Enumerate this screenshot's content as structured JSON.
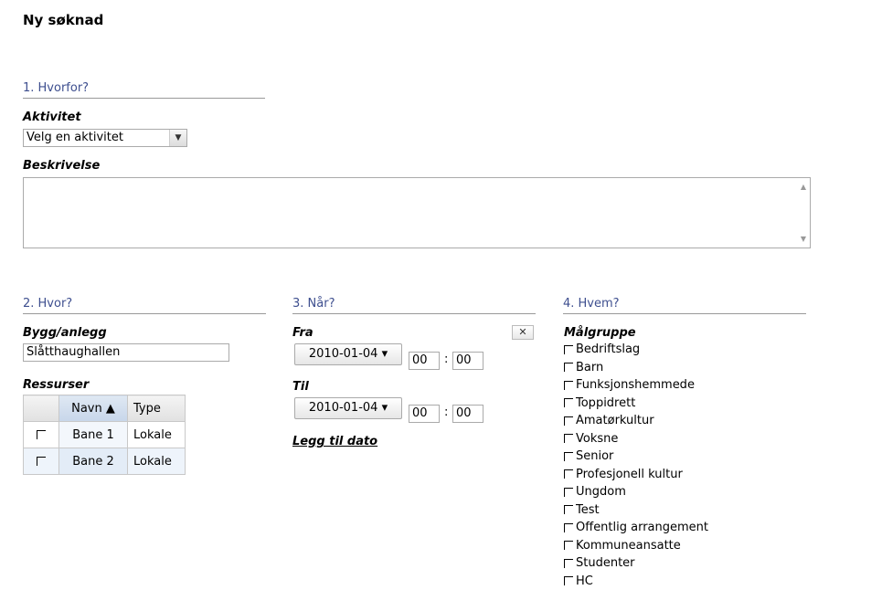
{
  "page_title": "Ny søknad",
  "section1": {
    "heading": "1. Hvorfor?",
    "activity_label": "Aktivitet",
    "activity_select": "Velg en aktivitet",
    "description_label": "Beskrivelse",
    "description_value": ""
  },
  "section2": {
    "heading": "2. Hvor?",
    "building_label": "Bygg/anlegg",
    "building_value": "Slåtthaughallen",
    "resources_label": "Ressurser",
    "table": {
      "columns": [
        "Navn ▲",
        "Type"
      ],
      "rows": [
        {
          "name": "Bane 1",
          "type": "Lokale"
        },
        {
          "name": "Bane 2",
          "type": "Lokale"
        }
      ]
    }
  },
  "section3": {
    "heading": "3. Når?",
    "from_label": "Fra",
    "from_date": "2010-01-04 ▾",
    "from_hour": "00",
    "from_minute": "00",
    "to_label": "Til",
    "to_date": "2010-01-04 ▾",
    "to_hour": "00",
    "to_minute": "00",
    "add_date_link": "Legg til dato",
    "colon": ":",
    "close_glyph": "✕"
  },
  "section4": {
    "heading": "4. Hvem?",
    "target_label": "Målgruppe",
    "options": [
      "Bedriftslag",
      "Barn",
      "Funksjonshemmede",
      "Toppidrett",
      "Amatørkultur",
      "Voksne",
      "Senior",
      "Profesjonell kultur",
      "Ungdom",
      "Test",
      "Offentlig arrangement",
      "Kommuneansatte",
      "Studenter",
      "HC"
    ]
  }
}
